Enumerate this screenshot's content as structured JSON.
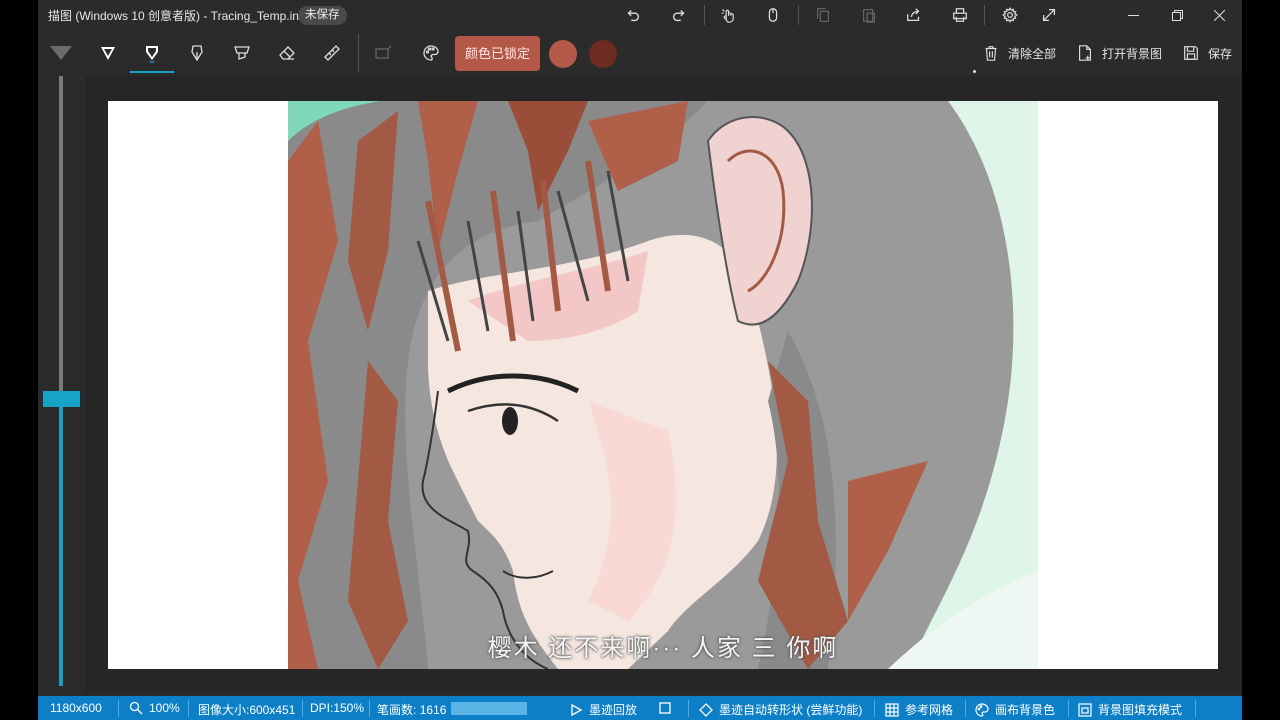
{
  "window": {
    "title": "描图 (Windows 10 创意者版) - Tracing_Temp.ink",
    "unsaved_badge": "未保存"
  },
  "titlebar_icons": [
    "undo-icon",
    "redo-icon",
    "touch-draw-icon",
    "mouse-icon",
    "copy-icon",
    "paste-icon",
    "share-icon",
    "print-icon",
    "settings-icon",
    "fullscreen-icon"
  ],
  "toolbar": {
    "tools": [
      "ballpoint-pen",
      "pencil",
      "calligraphy-pen",
      "highlighter",
      "eraser",
      "ruler",
      "lasso-select",
      "palette"
    ],
    "lock_color_label": "颜色已锁定",
    "color_primary": "#b4584a",
    "color_secondary": "#6e2b22",
    "clear_all_label": "清除全部",
    "open_background_label": "打开背景图",
    "save_label": "保存"
  },
  "slider": {
    "level": 0.45
  },
  "canvas": {
    "subtitle": "樱木  还不来啊···  人家  三  你啊"
  },
  "statusbar": {
    "canvas_size": "1180x600",
    "zoom": "100%",
    "image_size": "图像大小:600x451",
    "dpi": "DPI:150%",
    "stroke_count_label": "笔画数:",
    "stroke_count": "1616",
    "stroke_progress": 1.0,
    "replay_label": "墨迹回放",
    "auto_shape_label": "墨迹自动转形状 (尝鲜功能)",
    "grid_label": "参考网格",
    "canvas_bg_label": "画布背景色",
    "bg_fill_label": "背景图填充模式"
  }
}
